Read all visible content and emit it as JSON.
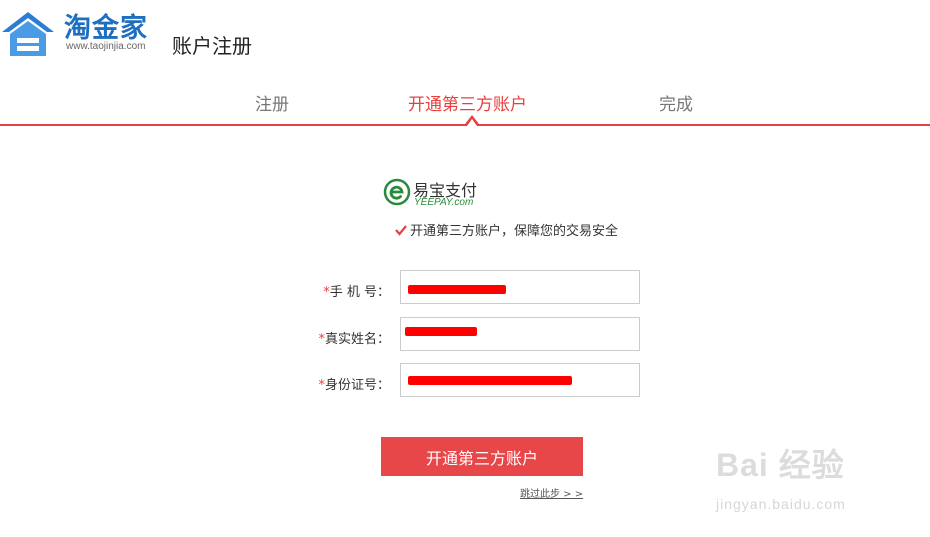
{
  "header": {
    "brand": "淘金家",
    "url": "www.taojinjia.com",
    "title": "账户注册"
  },
  "steps": [
    {
      "label": "注册",
      "active": false
    },
    {
      "label": "开通第三方账户",
      "active": true
    },
    {
      "label": "完成",
      "active": false
    }
  ],
  "yeepay": {
    "name": "易宝支付",
    "sub": "YEEPAY.com"
  },
  "agreement": {
    "checked": true,
    "text": "开通第三方账户，保障您的交易安全"
  },
  "form": {
    "fields": [
      {
        "required_mark": "*",
        "label": "手 机 号：",
        "value": "",
        "redacted": true
      },
      {
        "required_mark": "*",
        "label": "真实姓名：",
        "value": "",
        "redacted": true
      },
      {
        "required_mark": "*",
        "label": "身份证号：",
        "value": "",
        "redacted": true
      }
    ],
    "submit_label": "开通第三方账户",
    "skip_label": "跳过此步 > >"
  },
  "watermark": {
    "main": "Bai 经验",
    "sub": "jingyan.baidu.com"
  },
  "colors": {
    "accent": "#e84040",
    "brand_blue": "#1f6fc1",
    "button": "#e8474a",
    "redaction": "#ff0000"
  }
}
